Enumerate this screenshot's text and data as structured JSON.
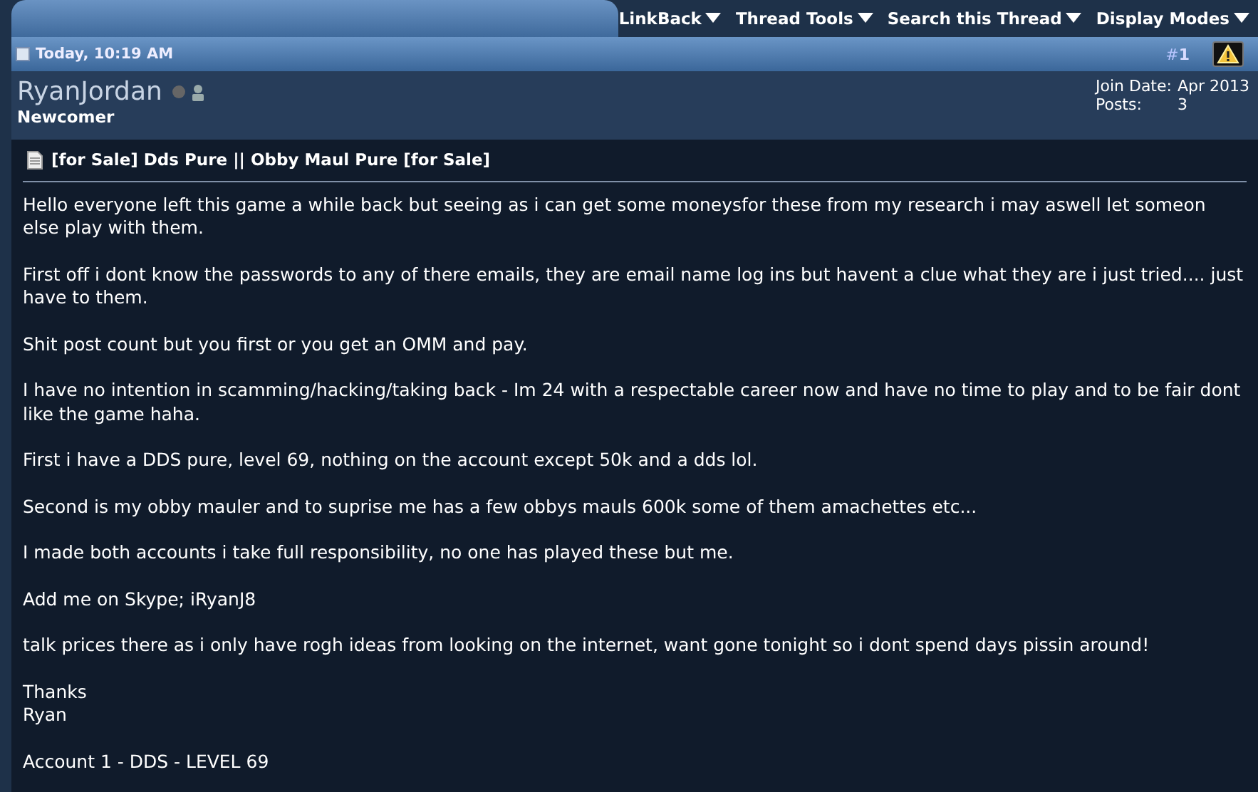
{
  "menu": [
    {
      "label": "LinkBack"
    },
    {
      "label": "Thread Tools"
    },
    {
      "label": "Search this Thread"
    },
    {
      "label": "Display Modes"
    }
  ],
  "post": {
    "date": "Today, 10:19 AM",
    "number_prefix": "#",
    "number": "1",
    "user": {
      "name": "RyanJordan",
      "online": false,
      "title": "Newcomer",
      "join_label": "Join Date:",
      "join_value": "Apr 2013",
      "posts_label": "Posts:",
      "posts_value": "3"
    },
    "title": "[for Sale] Dds Pure || Obby Maul Pure [for Sale]",
    "paragraphs": [
      {
        "lines": [
          "Hello everyone left this game a while back but seeing as i can get some moneysfor these from my research i may aswell let someon else play with them."
        ]
      },
      {
        "lines": [
          "First off i dont know the passwords to any of there emails, they are email name log ins but havent a clue what they are i just tried.... just have to them."
        ]
      },
      {
        "lines": [
          "Shit post count but you first or you get an OMM and pay."
        ]
      },
      {
        "lines": [
          "I have no intention in scamming/hacking/taking back - Im 24 with a respectable career now and have no time to play and to be fair dont like the game haha."
        ]
      },
      {
        "lines": [
          "First i have a DDS pure, level 69, nothing on the account except 50k and a dds lol."
        ]
      },
      {
        "lines": [
          "Second is my obby mauler and to suprise me has a few obbys mauls 600k some of them amachettes etc..."
        ]
      },
      {
        "lines": [
          "I made both accounts i take full responsibility, no one has played these but me."
        ]
      },
      {
        "lines": [
          "Add me on Skype; iRyanJ8"
        ]
      },
      {
        "lines": [
          "talk prices there as i only have rogh ideas from looking on the internet, want gone tonight so i dont spend days pissin around!"
        ]
      },
      {
        "lines": [
          "Thanks",
          "Ryan"
        ]
      },
      {
        "lines": [
          "Account 1 - DDS - LEVEL 69"
        ]
      }
    ]
  }
}
